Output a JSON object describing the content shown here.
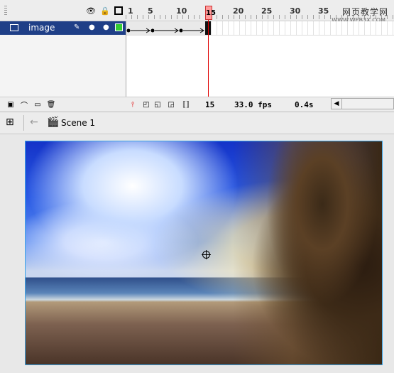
{
  "timeline": {
    "ruler_marks": [
      "1",
      "5",
      "10",
      "15",
      "20",
      "25",
      "30",
      "35"
    ],
    "playhead_frame": "15",
    "layer": {
      "name": "image"
    },
    "status": {
      "current_frame": "15",
      "fps": "33.0 fps",
      "time": "0.4s"
    }
  },
  "editbar": {
    "scene_label": "Scene 1"
  },
  "watermark": {
    "line1": "网页教学网",
    "line2": "WWW.WEB3X.COM"
  },
  "colors": {
    "layer_highlight": "#1f3f87",
    "playhead": "#e00000",
    "outline_color_swatch": "#33cc33",
    "stage_border": "#3aa3e6"
  }
}
